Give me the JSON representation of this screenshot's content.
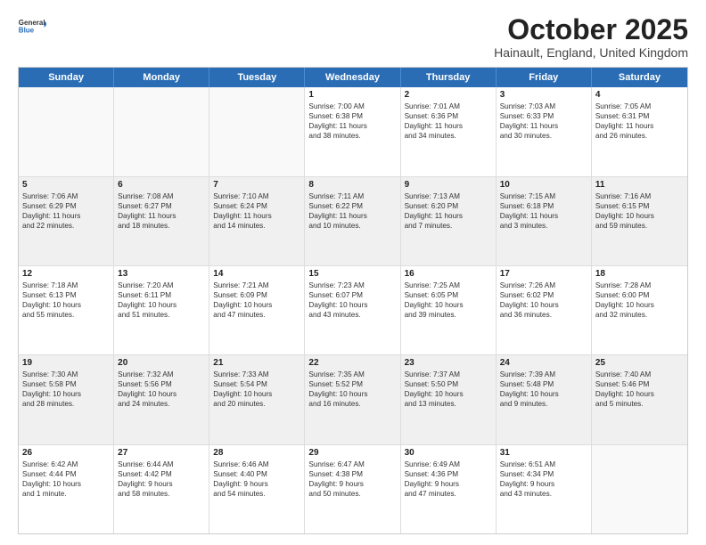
{
  "logo": {
    "general": "General",
    "blue": "Blue"
  },
  "title": "October 2025",
  "location": "Hainault, England, United Kingdom",
  "weekdays": [
    "Sunday",
    "Monday",
    "Tuesday",
    "Wednesday",
    "Thursday",
    "Friday",
    "Saturday"
  ],
  "rows": [
    [
      {
        "day": "",
        "lines": [],
        "empty": true
      },
      {
        "day": "",
        "lines": [],
        "empty": true
      },
      {
        "day": "",
        "lines": [],
        "empty": true
      },
      {
        "day": "1",
        "lines": [
          "Sunrise: 7:00 AM",
          "Sunset: 6:38 PM",
          "Daylight: 11 hours",
          "and 38 minutes."
        ]
      },
      {
        "day": "2",
        "lines": [
          "Sunrise: 7:01 AM",
          "Sunset: 6:36 PM",
          "Daylight: 11 hours",
          "and 34 minutes."
        ]
      },
      {
        "day": "3",
        "lines": [
          "Sunrise: 7:03 AM",
          "Sunset: 6:33 PM",
          "Daylight: 11 hours",
          "and 30 minutes."
        ]
      },
      {
        "day": "4",
        "lines": [
          "Sunrise: 7:05 AM",
          "Sunset: 6:31 PM",
          "Daylight: 11 hours",
          "and 26 minutes."
        ]
      }
    ],
    [
      {
        "day": "5",
        "lines": [
          "Sunrise: 7:06 AM",
          "Sunset: 6:29 PM",
          "Daylight: 11 hours",
          "and 22 minutes."
        ]
      },
      {
        "day": "6",
        "lines": [
          "Sunrise: 7:08 AM",
          "Sunset: 6:27 PM",
          "Daylight: 11 hours",
          "and 18 minutes."
        ]
      },
      {
        "day": "7",
        "lines": [
          "Sunrise: 7:10 AM",
          "Sunset: 6:24 PM",
          "Daylight: 11 hours",
          "and 14 minutes."
        ]
      },
      {
        "day": "8",
        "lines": [
          "Sunrise: 7:11 AM",
          "Sunset: 6:22 PM",
          "Daylight: 11 hours",
          "and 10 minutes."
        ]
      },
      {
        "day": "9",
        "lines": [
          "Sunrise: 7:13 AM",
          "Sunset: 6:20 PM",
          "Daylight: 11 hours",
          "and 7 minutes."
        ]
      },
      {
        "day": "10",
        "lines": [
          "Sunrise: 7:15 AM",
          "Sunset: 6:18 PM",
          "Daylight: 11 hours",
          "and 3 minutes."
        ]
      },
      {
        "day": "11",
        "lines": [
          "Sunrise: 7:16 AM",
          "Sunset: 6:15 PM",
          "Daylight: 10 hours",
          "and 59 minutes."
        ]
      }
    ],
    [
      {
        "day": "12",
        "lines": [
          "Sunrise: 7:18 AM",
          "Sunset: 6:13 PM",
          "Daylight: 10 hours",
          "and 55 minutes."
        ]
      },
      {
        "day": "13",
        "lines": [
          "Sunrise: 7:20 AM",
          "Sunset: 6:11 PM",
          "Daylight: 10 hours",
          "and 51 minutes."
        ]
      },
      {
        "day": "14",
        "lines": [
          "Sunrise: 7:21 AM",
          "Sunset: 6:09 PM",
          "Daylight: 10 hours",
          "and 47 minutes."
        ]
      },
      {
        "day": "15",
        "lines": [
          "Sunrise: 7:23 AM",
          "Sunset: 6:07 PM",
          "Daylight: 10 hours",
          "and 43 minutes."
        ]
      },
      {
        "day": "16",
        "lines": [
          "Sunrise: 7:25 AM",
          "Sunset: 6:05 PM",
          "Daylight: 10 hours",
          "and 39 minutes."
        ]
      },
      {
        "day": "17",
        "lines": [
          "Sunrise: 7:26 AM",
          "Sunset: 6:02 PM",
          "Daylight: 10 hours",
          "and 36 minutes."
        ]
      },
      {
        "day": "18",
        "lines": [
          "Sunrise: 7:28 AM",
          "Sunset: 6:00 PM",
          "Daylight: 10 hours",
          "and 32 minutes."
        ]
      }
    ],
    [
      {
        "day": "19",
        "lines": [
          "Sunrise: 7:30 AM",
          "Sunset: 5:58 PM",
          "Daylight: 10 hours",
          "and 28 minutes."
        ]
      },
      {
        "day": "20",
        "lines": [
          "Sunrise: 7:32 AM",
          "Sunset: 5:56 PM",
          "Daylight: 10 hours",
          "and 24 minutes."
        ]
      },
      {
        "day": "21",
        "lines": [
          "Sunrise: 7:33 AM",
          "Sunset: 5:54 PM",
          "Daylight: 10 hours",
          "and 20 minutes."
        ]
      },
      {
        "day": "22",
        "lines": [
          "Sunrise: 7:35 AM",
          "Sunset: 5:52 PM",
          "Daylight: 10 hours",
          "and 16 minutes."
        ]
      },
      {
        "day": "23",
        "lines": [
          "Sunrise: 7:37 AM",
          "Sunset: 5:50 PM",
          "Daylight: 10 hours",
          "and 13 minutes."
        ]
      },
      {
        "day": "24",
        "lines": [
          "Sunrise: 7:39 AM",
          "Sunset: 5:48 PM",
          "Daylight: 10 hours",
          "and 9 minutes."
        ]
      },
      {
        "day": "25",
        "lines": [
          "Sunrise: 7:40 AM",
          "Sunset: 5:46 PM",
          "Daylight: 10 hours",
          "and 5 minutes."
        ]
      }
    ],
    [
      {
        "day": "26",
        "lines": [
          "Sunrise: 6:42 AM",
          "Sunset: 4:44 PM",
          "Daylight: 10 hours",
          "and 1 minute."
        ]
      },
      {
        "day": "27",
        "lines": [
          "Sunrise: 6:44 AM",
          "Sunset: 4:42 PM",
          "Daylight: 9 hours",
          "and 58 minutes."
        ]
      },
      {
        "day": "28",
        "lines": [
          "Sunrise: 6:46 AM",
          "Sunset: 4:40 PM",
          "Daylight: 9 hours",
          "and 54 minutes."
        ]
      },
      {
        "day": "29",
        "lines": [
          "Sunrise: 6:47 AM",
          "Sunset: 4:38 PM",
          "Daylight: 9 hours",
          "and 50 minutes."
        ]
      },
      {
        "day": "30",
        "lines": [
          "Sunrise: 6:49 AM",
          "Sunset: 4:36 PM",
          "Daylight: 9 hours",
          "and 47 minutes."
        ]
      },
      {
        "day": "31",
        "lines": [
          "Sunrise: 6:51 AM",
          "Sunset: 4:34 PM",
          "Daylight: 9 hours",
          "and 43 minutes."
        ]
      },
      {
        "day": "",
        "lines": [],
        "empty": true
      }
    ]
  ]
}
